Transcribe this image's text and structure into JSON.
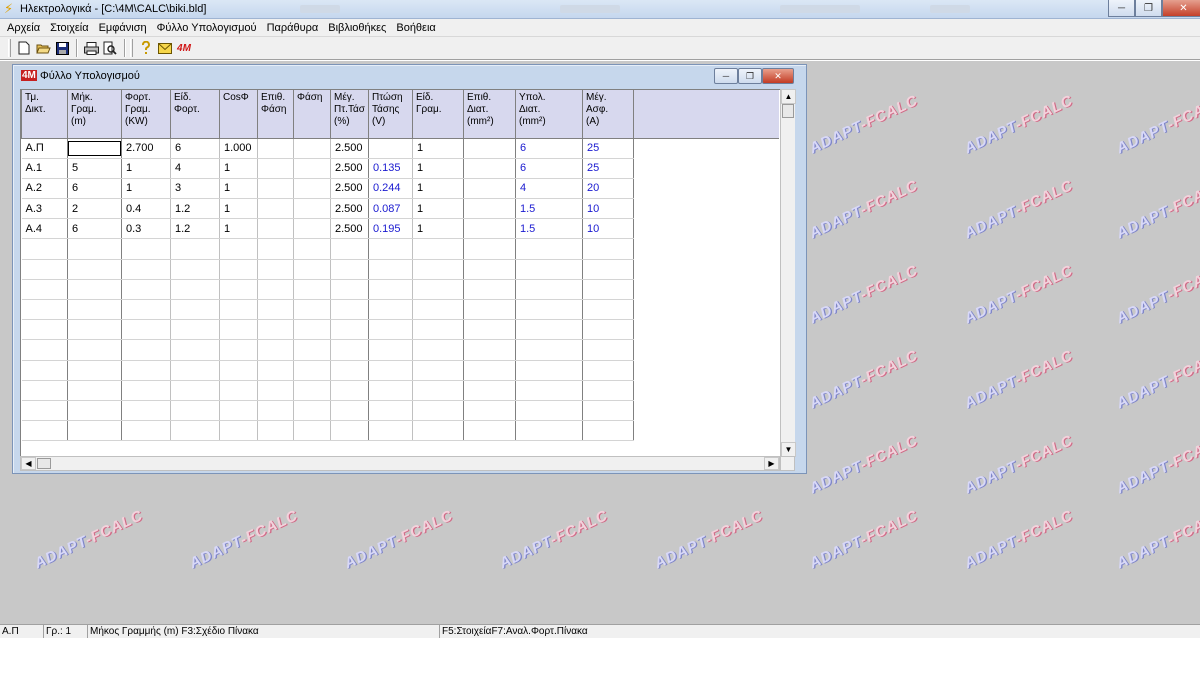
{
  "window": {
    "title": "Ηλεκτρολογικά - [C:\\4M\\CALC\\biki.bld]",
    "minimize_glyph": "─",
    "restore_glyph": "❐",
    "close_glyph": "✕"
  },
  "menu": [
    "Αρχεία",
    "Στοιχεία",
    "Εμφάνιση",
    "Φύλλο Υπολογισμού",
    "Παράθυρα",
    "Βιβλιοθήκες",
    "Βοήθεια"
  ],
  "toolbar": {
    "icons": [
      "new-file-icon",
      "open-folder-icon",
      "save-icon",
      "print-icon",
      "print-preview-icon",
      "help-icon",
      "mail-icon",
      "4m-logo-icon"
    ],
    "logo_text": "4M"
  },
  "child_window": {
    "icon_text": "4M",
    "title": "Φύλλο Υπολογισμού"
  },
  "sheet": {
    "headers": [
      [
        "Τμ.",
        "Δικτ."
      ],
      [
        "Μήκ.",
        "Γραμ.",
        "(m)"
      ],
      [
        "Φορτ.",
        "Γραμ.",
        "(KW)"
      ],
      [
        "Είδ.",
        "Φορτ."
      ],
      [
        "CosΦ"
      ],
      [
        "Επιθ.",
        "Φάση"
      ],
      [
        "Φάση"
      ],
      [
        "Μέγ.",
        "Πτ.Τάσ",
        "(%)"
      ],
      [
        "Πτώση",
        "Τάσης",
        "(V)"
      ],
      [
        "Είδ.",
        "Γραμ."
      ],
      [
        "Επιθ.",
        "Διατ.",
        "(mm²)"
      ],
      [
        "Υπολ.",
        "Διατ.",
        "(mm²)"
      ],
      [
        "Μέγ.",
        "Ασφ.",
        "(A)"
      ]
    ],
    "rows": [
      [
        "Α.Π",
        "",
        "2.700",
        "6",
        "1.000",
        "",
        "",
        "2.500",
        "",
        "1",
        "",
        "6",
        "25"
      ],
      [
        "Α.1",
        "5",
        "1",
        "4",
        "1",
        "",
        "",
        "2.500",
        "0.135",
        "1",
        "",
        "6",
        "25"
      ],
      [
        "Α.2",
        "6",
        "1",
        "3",
        "1",
        "",
        "",
        "2.500",
        "0.244",
        "1",
        "",
        "4",
        "20"
      ],
      [
        "Α.3",
        "2",
        "0.4",
        "1.2",
        "1",
        "",
        "",
        "2.500",
        "0.087",
        "1",
        "",
        "1.5",
        "10"
      ],
      [
        "Α.4",
        "6",
        "0.3",
        "1.2",
        "1",
        "",
        "",
        "2.500",
        "0.195",
        "1",
        "",
        "1.5",
        "10"
      ]
    ],
    "empty_rows": 10,
    "computed_columns": [
      8,
      11,
      12
    ],
    "computed_color": "#1a1ad0"
  },
  "watermark": {
    "part_a": "ADAPT",
    "part_b": "-FCALC"
  },
  "status_bar": {
    "section": "Α.Π",
    "line": "Γρ.: 1",
    "hint": "Μήκος Γραμμής (m) F3:Σχέδιο Πίνακα",
    "keys": "F5:ΣτοιχείαF7:Αναλ.Φορτ.Πίνακα"
  }
}
